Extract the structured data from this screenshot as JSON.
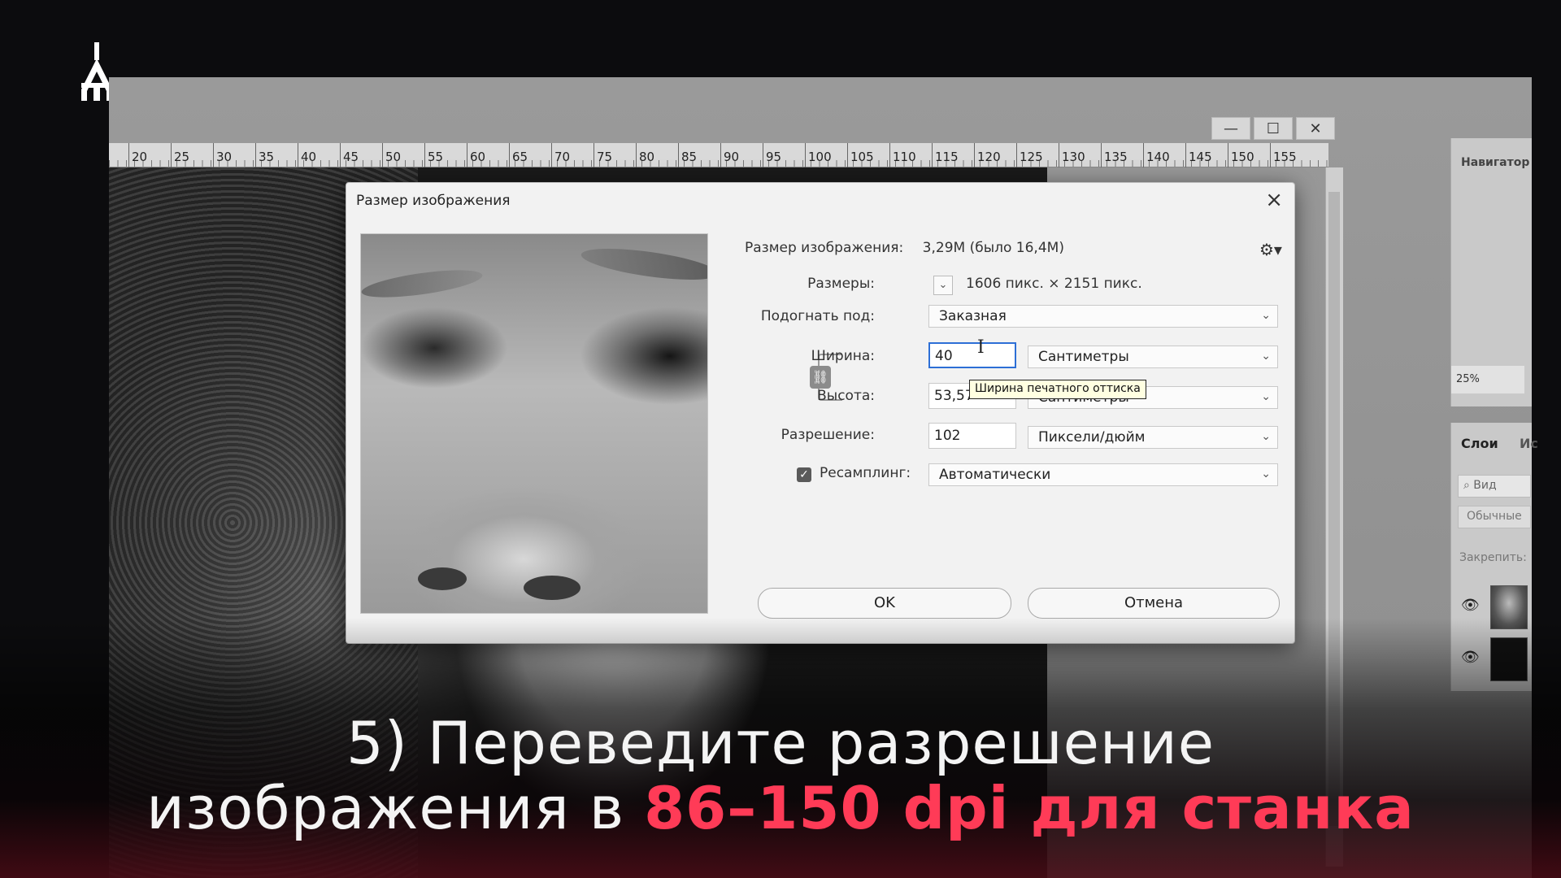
{
  "workspace": {
    "ruler_ticks": [
      "20",
      "25",
      "30",
      "35",
      "40",
      "45",
      "50",
      "55",
      "60",
      "65",
      "70",
      "75",
      "80",
      "85",
      "90",
      "95",
      "100",
      "105",
      "110",
      "115",
      "120",
      "125",
      "130",
      "135",
      "140",
      "145",
      "150",
      "155"
    ],
    "window_controls": [
      "—",
      "☐",
      "✕"
    ],
    "navigator_title": "Навигатор",
    "zoom": "25%",
    "layers_tab": "Слои",
    "layers_tab2": "Ис",
    "layers_search_placeholder": "Вид",
    "blend_mode": "Обычные",
    "lock_label": "Закрепить:"
  },
  "dialog": {
    "title": "Размер изображения",
    "image_size_label": "Размер изображения:",
    "image_size_value": "3,29M (было 16,4M)",
    "dimensions_label": "Размеры:",
    "dimensions_value": "1606 пикс.  ×  2151 пикс.",
    "fit_label": "Подогнать под:",
    "fit_value": "Заказная",
    "width_label": "Ширина:",
    "width_value": "40",
    "width_unit": "Сантиметры",
    "height_label": "Высота:",
    "height_value": "53,57",
    "height_unit": "Сантиметры",
    "resolution_label": "Разрешение:",
    "resolution_value": "102",
    "resolution_unit": "Пиксели/дюйм",
    "resample_label": "Ресамплинг:",
    "resample_value": "Автоматически",
    "tooltip": "Ширина печатного оттиска",
    "ok_label": "OK",
    "cancel_label": "Отмена"
  },
  "caption": {
    "line1": "5) Переведите разрешение",
    "line2_prefix": "изображения в ",
    "line2_accent": "86–150 dpi для станка"
  },
  "colors": {
    "accent": "#ff3b57",
    "focus": "#2d6fd6"
  }
}
